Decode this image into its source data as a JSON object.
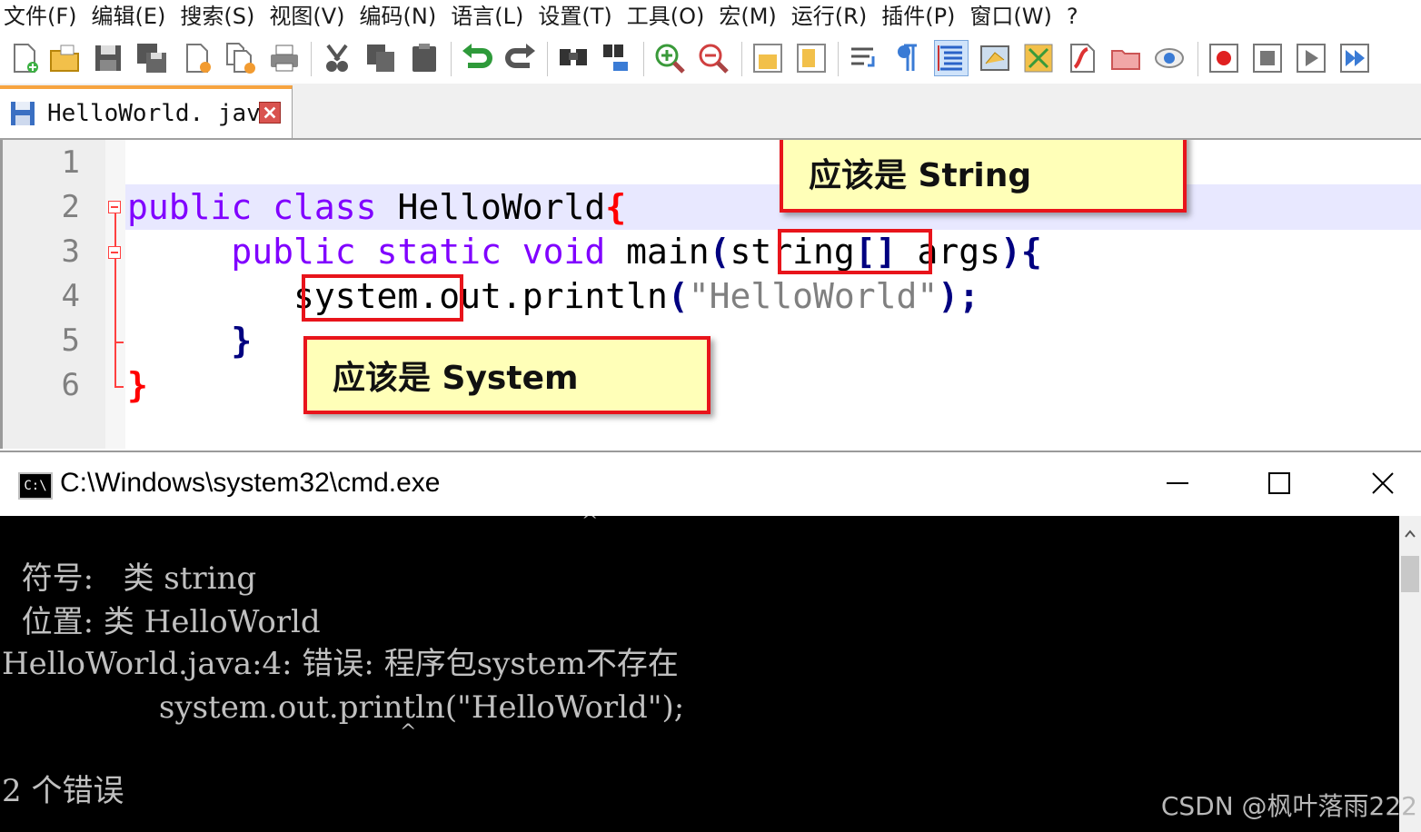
{
  "menubar": {
    "items": [
      "文件(F)",
      "编辑(E)",
      "搜索(S)",
      "视图(V)",
      "编码(N)",
      "语言(L)",
      "设置(T)",
      "工具(O)",
      "宏(M)",
      "运行(R)",
      "插件(P)",
      "窗口(W)",
      "?"
    ]
  },
  "editor": {
    "tab_name": "HelloWorld. java",
    "line_numbers": [
      "1",
      "2",
      "3",
      "4",
      "5",
      "6"
    ],
    "code": {
      "l2_kw1": "public",
      "l2_kw2": "class",
      "l2_name": " HelloWorld",
      "l2_brace": "{",
      "l3_indent": "     ",
      "l3_kw1": "public",
      "l3_kw2": "static",
      "l3_kw3": "void",
      "l3_name": " main",
      "l3_paren": "(",
      "l3_type": "string",
      "l3_brackets": "[]",
      "l3_args": " args",
      "l3_close": "){",
      "l4_indent": "        ",
      "l4_sys": "system",
      "l4_rest": ".out.println",
      "l4_paren": "(",
      "l4_str": "\"HelloWorld\"",
      "l4_close": ");",
      "l5_indent": "     ",
      "l5_brace": "}",
      "l6_brace": "}"
    },
    "callout_string": "应该是 String",
    "callout_system": "应该是 System"
  },
  "cmd": {
    "title": "C:\\Windows\\system32\\cmd.exe",
    "lines": [
      "  符号:   类 string",
      "  位置: 类 HelloWorld",
      "HelloWorld.java:4: 错误: 程序包system不存在",
      "                system.out.println(\"HelloWorld\");",
      "2 个错误"
    ],
    "caret": "^"
  },
  "watermark": "CSDN @枫叶落雨222",
  "colors": {
    "keyword": "#8000ff",
    "callout_bg": "#ffffb8",
    "callout_border": "#e8141b",
    "tab_accent": "#f7a440",
    "cmd_bg": "#000000",
    "cmd_text": "#c0c0c0"
  },
  "toolbar_icons": [
    "new-file-icon",
    "open-file-icon",
    "save-icon",
    "save-all-icon",
    "close-icon",
    "close-all-icon",
    "print-icon",
    "cut-icon",
    "copy-icon",
    "paste-icon",
    "undo-icon",
    "redo-icon",
    "find-icon",
    "replace-icon",
    "zoom-in-icon",
    "zoom-out-icon",
    "sync-vertical-icon",
    "sync-horizontal-icon",
    "word-wrap-icon",
    "show-all-chars-icon",
    "indent-guide-icon",
    "doc-map-icon",
    "function-list-icon",
    "folder-workspace-icon",
    "monitor-icon",
    "record-macro-icon",
    "stop-record-icon",
    "play-macro-icon",
    "run-macro-multiple-icon"
  ]
}
